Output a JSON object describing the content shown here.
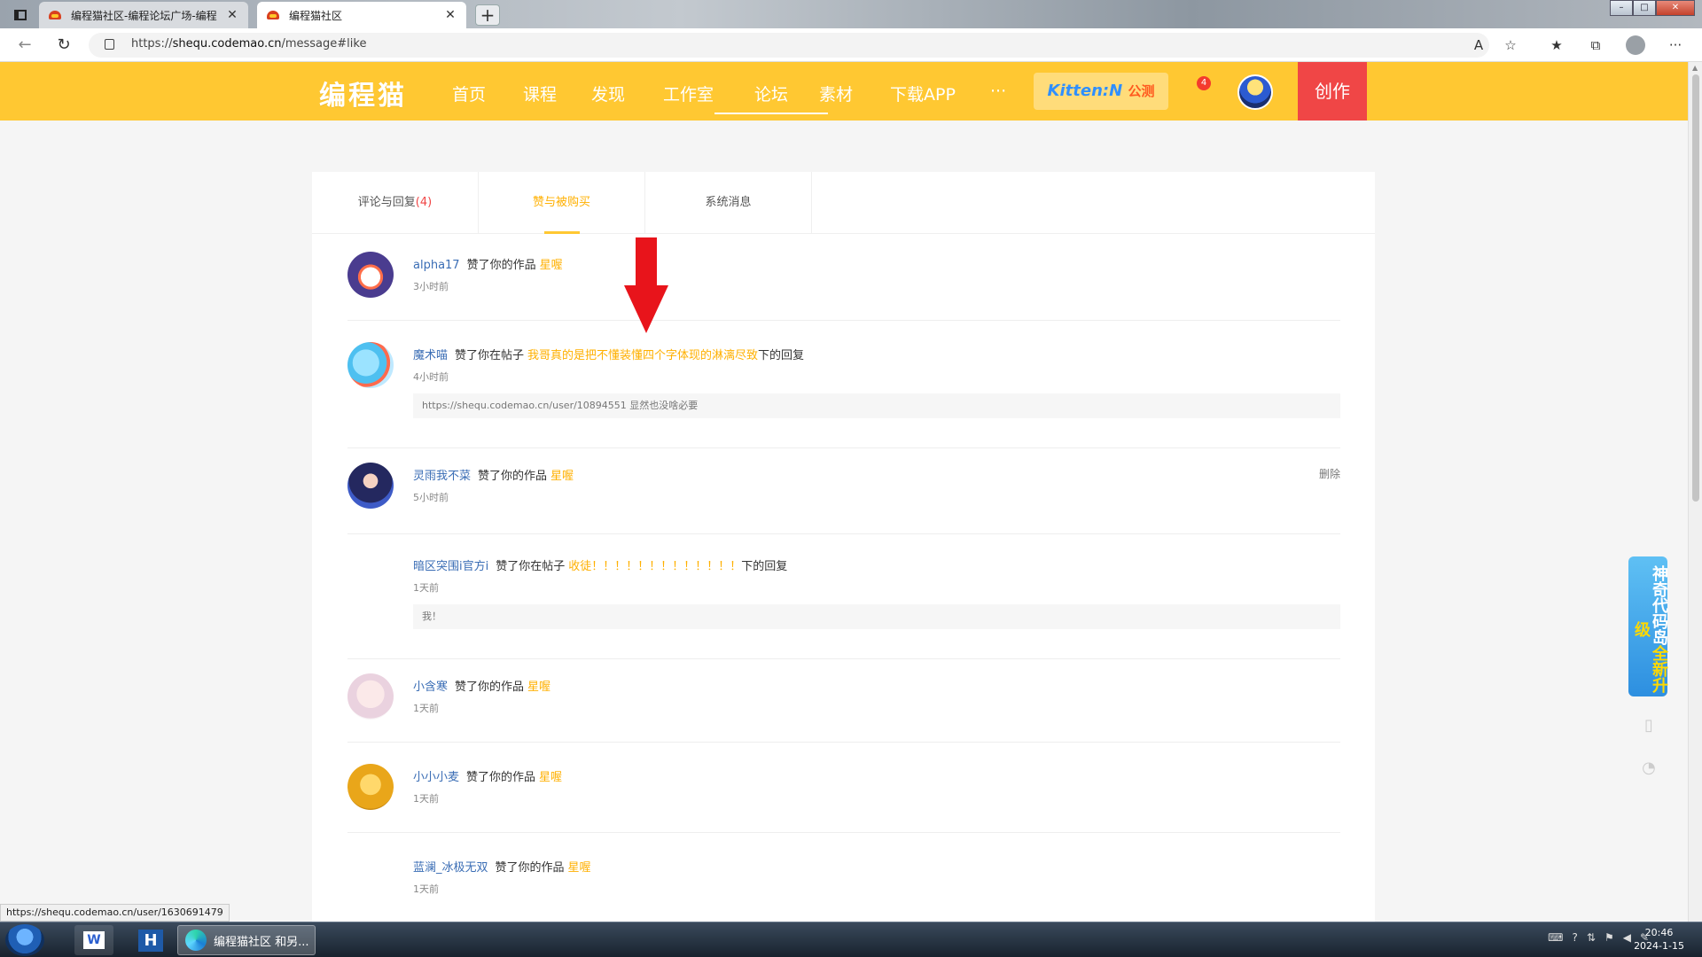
{
  "browser": {
    "tabs": [
      {
        "title": "编程猫社区-编程论坛广场-编程",
        "active": false
      },
      {
        "title": "编程猫社区",
        "active": true
      }
    ],
    "url_prefix": "https://",
    "url_host": "shequ.codemao.cn",
    "url_path": "/message#like"
  },
  "site": {
    "logo": "编程猫",
    "nav": [
      "首页",
      "课程",
      "发现",
      "工作室",
      "论坛",
      "素材",
      "下载APP",
      "···"
    ],
    "kitten_label": "Kitten",
    "kitten_n": "N",
    "kitten_tag": "公测",
    "notify_count": "4",
    "create_label": "创作"
  },
  "message_tabs": [
    {
      "label": "评论与回复",
      "count": "(4)"
    },
    {
      "label": "赞与被购买",
      "count": ""
    },
    {
      "label": "系统消息",
      "count": ""
    }
  ],
  "messages": [
    {
      "user": "alpha17",
      "action": "赞了你的作品",
      "target": "星喔",
      "suffix": "",
      "time": "3小时前",
      "quote": "",
      "delete": ""
    },
    {
      "user": "魔术喵",
      "action": "赞了你在帖子",
      "target": "我哥真的是把不懂装懂四个字体现的淋漓尽致",
      "suffix": "下的回复",
      "time": "4小时前",
      "quote": "https://shequ.codemao.cn/user/10894551 显然也没啥必要",
      "delete": ""
    },
    {
      "user": "灵雨我不菜",
      "action": "赞了你的作品",
      "target": "星喔",
      "suffix": "",
      "time": "5小时前",
      "quote": "",
      "delete": "删除"
    },
    {
      "user": "暗区突围i官方i",
      "action": "赞了你在帖子",
      "target": "收徒！！！！！！！！！！！！！",
      "suffix": "下的回复",
      "time": "1天前",
      "quote": "我！",
      "delete": ""
    },
    {
      "user": "小含寒",
      "action": "赞了你的作品",
      "target": "星喔",
      "suffix": "",
      "time": "1天前",
      "quote": "",
      "delete": ""
    },
    {
      "user": "小小小麦",
      "action": "赞了你的作品",
      "target": "星喔",
      "suffix": "",
      "time": "1天前",
      "quote": "",
      "delete": ""
    },
    {
      "user": "蓝澜_冰极无双",
      "action": "赞了你的作品",
      "target": "星喔",
      "suffix": "",
      "time": "1天前",
      "quote": "",
      "delete": ""
    }
  ],
  "float_ad": {
    "text_a": "神奇代码岛",
    "text_b": "全新升级"
  },
  "status_link": "https://shequ.codemao.cn/user/1630691479",
  "taskbar": {
    "edge_label": "编程猫社区 和另...",
    "time": "20:46",
    "date": "2024-1-15"
  },
  "colors": {
    "brand": "#ffc832",
    "accent": "#ffb000",
    "create": "#f04646",
    "user_link": "#3a6db5"
  }
}
